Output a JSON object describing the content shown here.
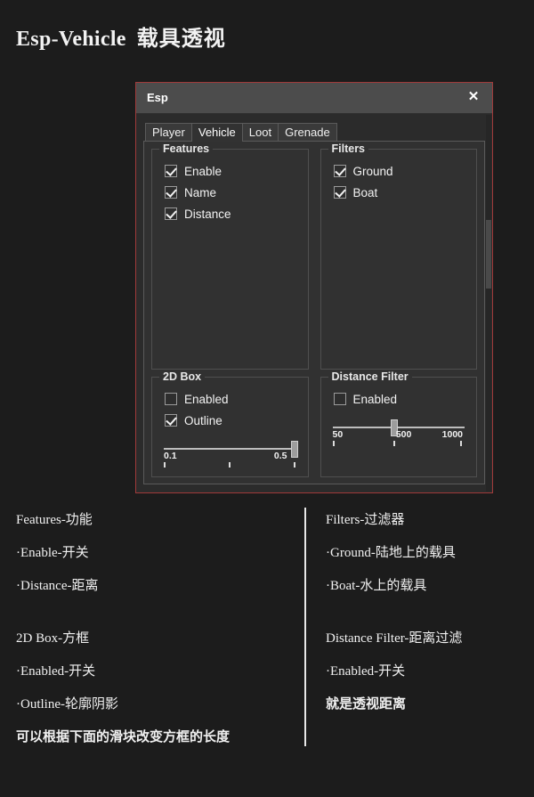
{
  "page": {
    "title_en": "Esp-Vehicle",
    "title_cn": "载具透视"
  },
  "dialog": {
    "title": "Esp",
    "close_icon": "✕",
    "tabs": [
      {
        "label": "Player",
        "active": false
      },
      {
        "label": "Vehicle",
        "active": true
      },
      {
        "label": "Loot",
        "active": false
      },
      {
        "label": "Grenade",
        "active": false
      }
    ],
    "groups": {
      "features": {
        "title": "Features",
        "checkboxes": [
          {
            "label": "Enable",
            "checked": true
          },
          {
            "label": "Name",
            "checked": true
          },
          {
            "label": "Distance",
            "checked": true
          }
        ]
      },
      "filters": {
        "title": "Filters",
        "checkboxes": [
          {
            "label": "Ground",
            "checked": true
          },
          {
            "label": "Boat",
            "checked": true
          }
        ]
      },
      "box2d": {
        "title": "2D Box",
        "checkboxes": [
          {
            "label": "Enabled",
            "checked": false
          },
          {
            "label": "Outline",
            "checked": true
          }
        ],
        "slider": {
          "min_label": "0.1",
          "max_label": "0.5",
          "value_percent": 100
        }
      },
      "distance_filter": {
        "title": "Distance Filter",
        "checkboxes": [
          {
            "label": "Enabled",
            "checked": false
          }
        ],
        "slider": {
          "tick_labels": [
            "50",
            "500",
            "1000"
          ],
          "value_percent": 47
        }
      }
    }
  },
  "notes": {
    "left": [
      "Features-功能",
      "·Enable-开关",
      "·Distance-距离",
      "",
      "2D Box-方框",
      "·Enabled-开关",
      "·Outline-轮廓阴影",
      "可以根据下面的滑块改变方框的长度"
    ],
    "right": [
      "Filters-过滤器",
      "·Ground-陆地上的载具",
      "·Boat-水上的载具",
      "",
      "Distance Filter-距离过滤",
      "·Enabled-开关",
      "就是透视距离"
    ]
  },
  "colors": {
    "background": "#1c1c1c",
    "dialog_border": "#a03a3a",
    "dialog_body": "#2b2b2b",
    "tabpage": "#313131",
    "titlebar": "#4c4c4c",
    "text": "#f2f2f2"
  }
}
